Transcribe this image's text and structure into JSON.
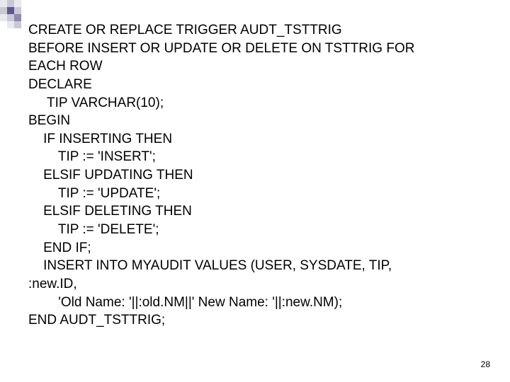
{
  "slide_number": "28",
  "code": {
    "l01": "CREATE OR REPLACE TRIGGER AUDT_TSTTRIG",
    "l02": "BEFORE INSERT OR UPDATE OR DELETE ON TSTTRIG FOR",
    "l03": "EACH ROW",
    "l04": "DECLARE",
    "l05": "     TIP VARCHAR(10);",
    "l06": "BEGIN",
    "l07": "    IF INSERTING THEN",
    "l08": "        TIP := 'INSERT';",
    "l09": "    ELSIF UPDATING THEN",
    "l10": "        TIP := 'UPDATE';",
    "l11": "    ELSIF DELETING THEN",
    "l12": "        TIP := 'DELETE';",
    "l13": "    END IF;",
    "l14": "    INSERT INTO MYAUDIT VALUES (USER, SYSDATE, TIP,",
    "l15": ":new.ID,",
    "l16": "        'Old Name: '||:old.NM||' New Name: '||:new.NM);",
    "l17": "END AUDT_TSTTRIG;"
  }
}
